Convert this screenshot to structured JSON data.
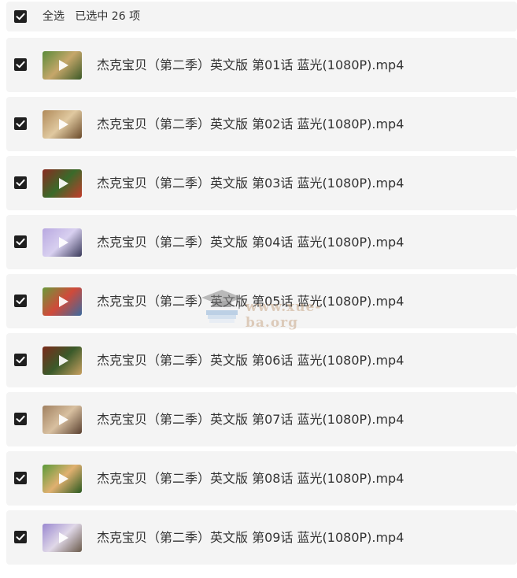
{
  "header": {
    "select_all_label": "全选",
    "selected_text": "已选中 26 项",
    "checked": true
  },
  "files": [
    {
      "name": "杰克宝贝（第二季）英文版 第01话 蓝光(1080P).mp4",
      "checked": true,
      "thumb_colors": [
        "#5a8a3a",
        "#c6a76a",
        "#3c5a28"
      ],
      "thumb_icon": "video-thumbnail"
    },
    {
      "name": "杰克宝贝（第二季）英文版 第02话 蓝光(1080P).mp4",
      "checked": true,
      "thumb_colors": [
        "#b08a5a",
        "#e0c9a0",
        "#6a4a2a"
      ],
      "thumb_icon": "video-thumbnail"
    },
    {
      "name": "杰克宝贝（第二季）英文版 第03话 蓝光(1080P).mp4",
      "checked": true,
      "thumb_colors": [
        "#8a2a20",
        "#3a6a2a",
        "#c43a2a"
      ],
      "thumb_icon": "video-thumbnail"
    },
    {
      "name": "杰克宝贝（第二季）英文版 第04话 蓝光(1080P).mp4",
      "checked": true,
      "thumb_colors": [
        "#b8a8e0",
        "#d8d0f0",
        "#3a3a5a"
      ],
      "thumb_icon": "video-thumbnail"
    },
    {
      "name": "杰克宝贝（第二季）英文版 第05话 蓝光(1080P).mp4",
      "checked": true,
      "thumb_colors": [
        "#6a9a3a",
        "#d04a3a",
        "#3a6aa0"
      ],
      "thumb_icon": "video-thumbnail"
    },
    {
      "name": "杰克宝贝（第二季）英文版 第06话 蓝光(1080P).mp4",
      "checked": true,
      "thumb_colors": [
        "#7a2a1a",
        "#3a5a2a",
        "#c8a060"
      ],
      "thumb_icon": "video-thumbnail"
    },
    {
      "name": "杰克宝贝（第二季）英文版 第07话 蓝光(1080P).mp4",
      "checked": true,
      "thumb_colors": [
        "#a08060",
        "#d8c0a0",
        "#5a4030"
      ],
      "thumb_icon": "video-thumbnail"
    },
    {
      "name": "杰克宝贝（第二季）英文版 第08话 蓝光(1080P).mp4",
      "checked": true,
      "thumb_colors": [
        "#5a9a3a",
        "#e0b070",
        "#2a5a20"
      ],
      "thumb_icon": "video-thumbnail"
    },
    {
      "name": "杰克宝贝（第二季）英文版 第09话 蓝光(1080P).mp4",
      "checked": true,
      "thumb_colors": [
        "#9a88d0",
        "#e0d8e8",
        "#6a5a4a"
      ],
      "thumb_icon": "video-thumbnail"
    }
  ],
  "watermark": {
    "text": "www.xue-ba.org"
  },
  "colors": {
    "row_bg": "#f4f4f4",
    "checkbox": "#1f1f1f",
    "text": "#333333"
  }
}
